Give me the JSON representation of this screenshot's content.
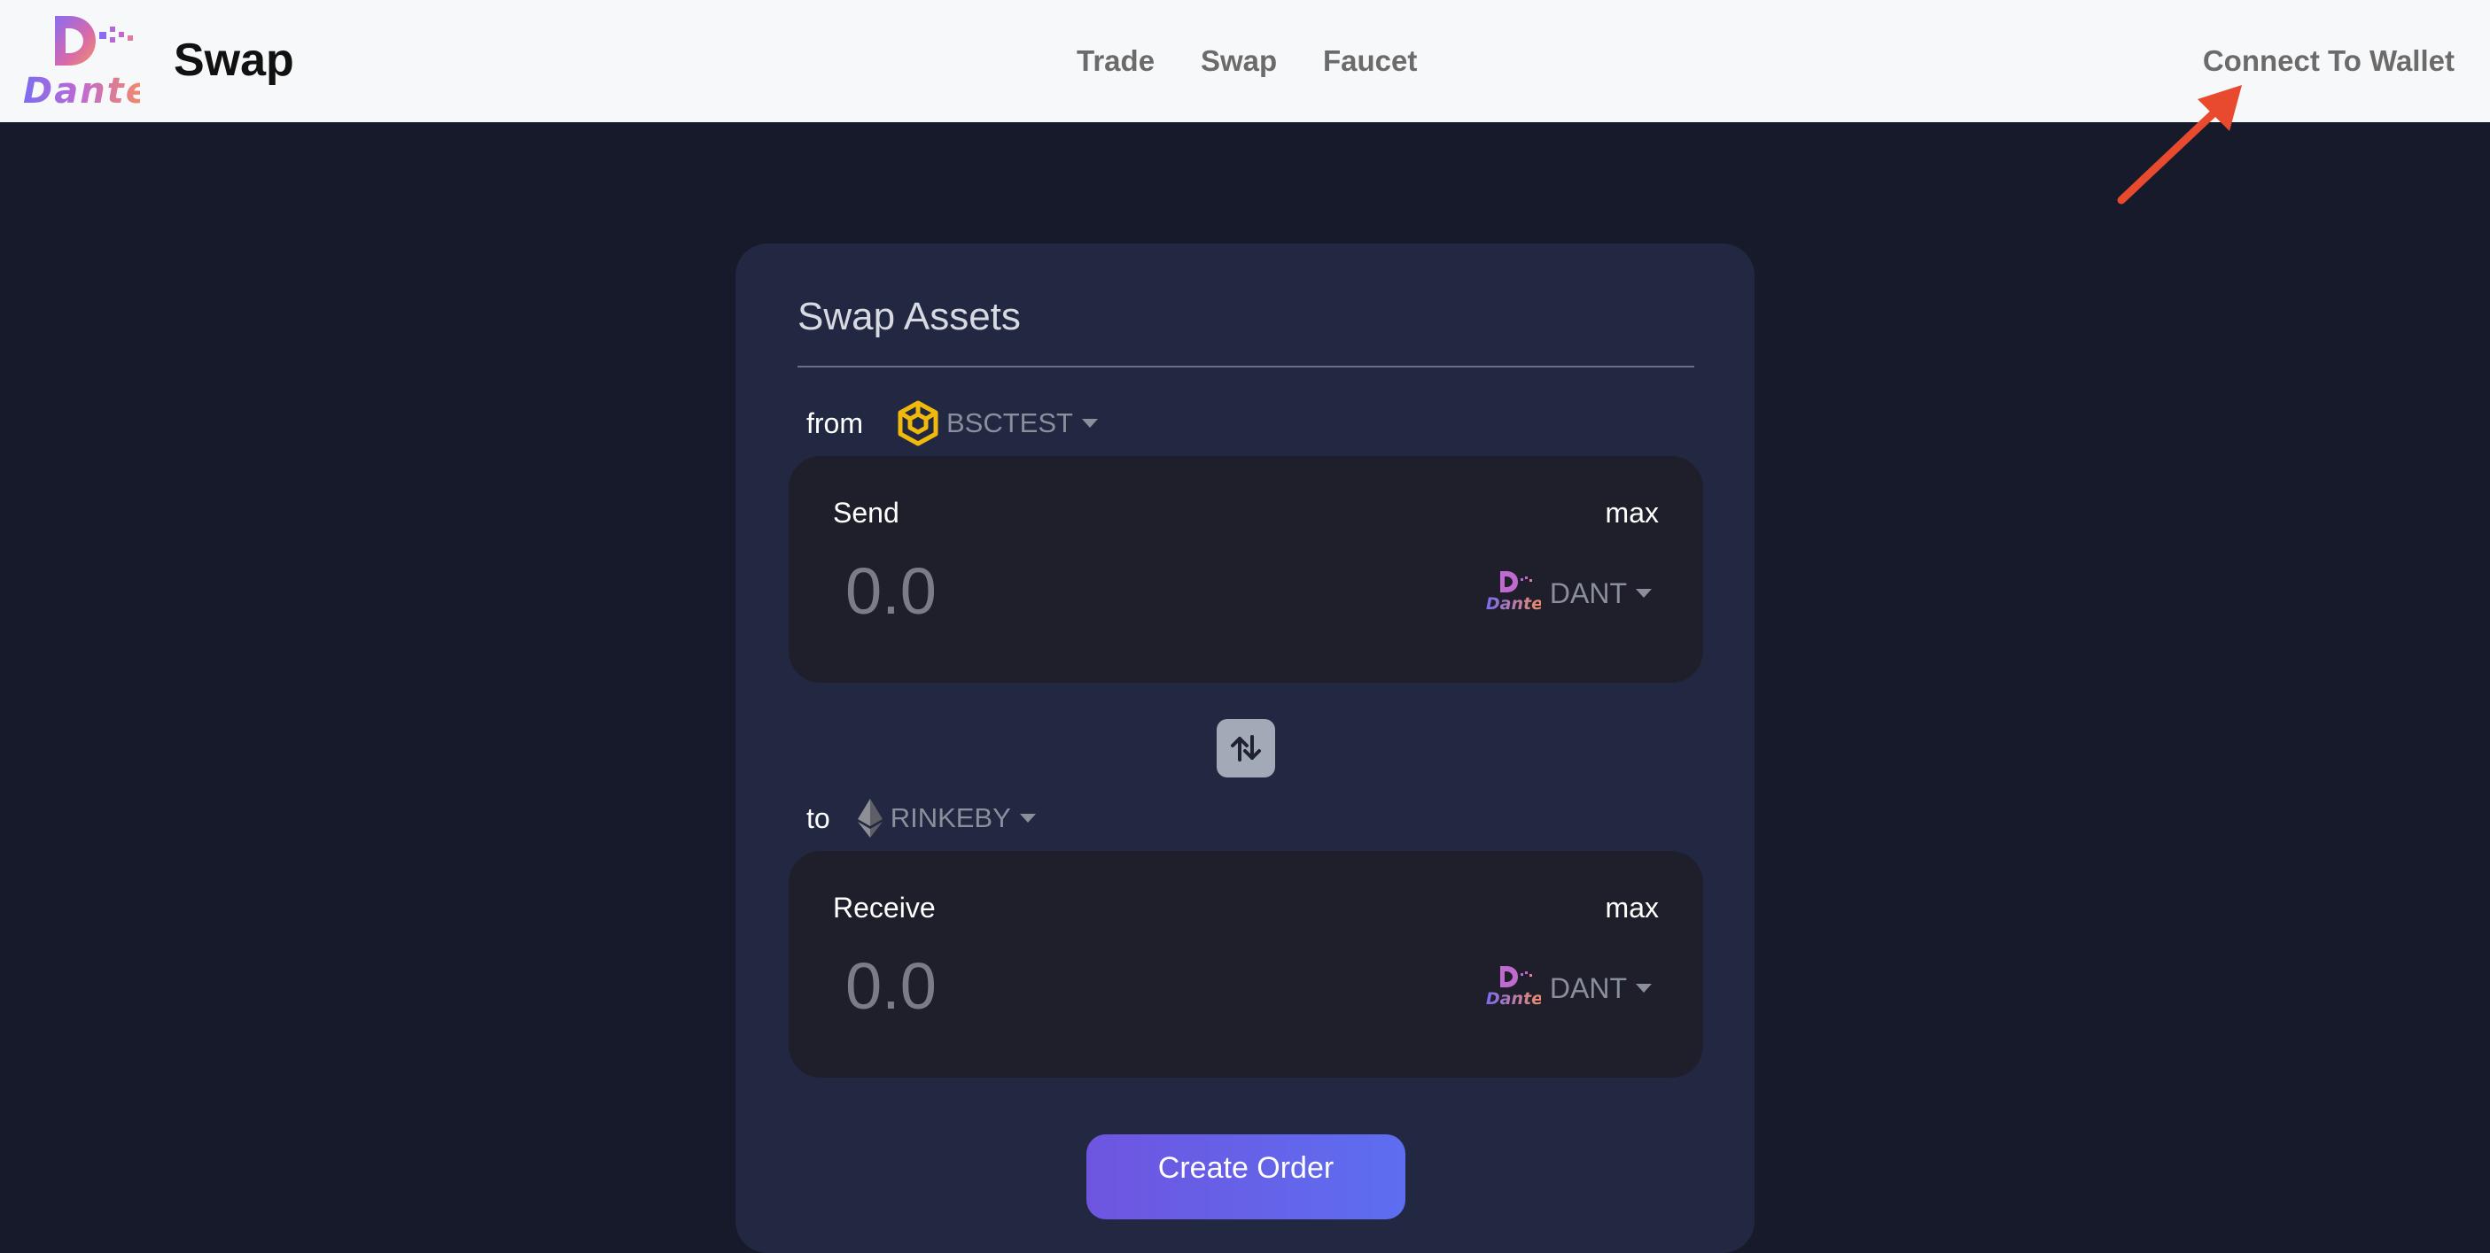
{
  "header": {
    "logo_text": "Dante",
    "page_title": "Swap",
    "nav": [
      "Trade",
      "Swap",
      "Faucet"
    ],
    "connect_wallet": "Connect To Wallet"
  },
  "swap": {
    "title": "Swap Assets",
    "from": {
      "label": "from",
      "chain": "BSCTEST",
      "box_label": "Send",
      "max": "max",
      "amount_placeholder": "0.0",
      "token": "DANT",
      "token_logo_text": "Dante"
    },
    "to": {
      "label": "to",
      "chain": "RINKEBY",
      "box_label": "Receive",
      "max": "max",
      "amount_placeholder": "0.0",
      "token": "DANT",
      "token_logo_text": "Dante"
    },
    "submit": "Create Order"
  },
  "colors": {
    "page_bg": "#161a2b",
    "card_bg": "#222841",
    "box_bg": "#1e1f2a",
    "accent": "#6e55e0",
    "annotation_arrow": "#e84a2e"
  }
}
